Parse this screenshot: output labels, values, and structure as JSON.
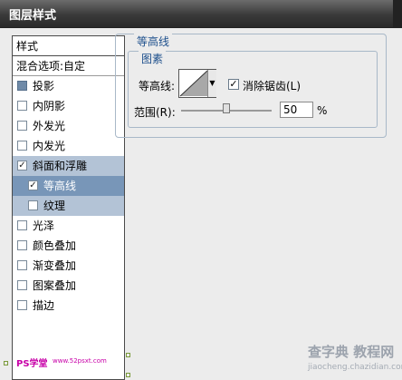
{
  "window": {
    "title": "图层样式"
  },
  "sidebar": {
    "header": "样式",
    "blend_options": "混合选项:自定",
    "items": [
      {
        "label": "投影",
        "checked": false
      },
      {
        "label": "内阴影",
        "checked": false
      },
      {
        "label": "外发光",
        "checked": false
      },
      {
        "label": "内发光",
        "checked": false
      },
      {
        "label": "斜面和浮雕",
        "checked": true
      },
      {
        "label": "等高线",
        "checked": true
      },
      {
        "label": "纹理",
        "checked": false
      },
      {
        "label": "光泽",
        "checked": false
      },
      {
        "label": "颜色叠加",
        "checked": false
      },
      {
        "label": "渐变叠加",
        "checked": false
      },
      {
        "label": "图案叠加",
        "checked": false
      },
      {
        "label": "描边",
        "checked": false
      }
    ]
  },
  "contour": {
    "group_title": "等高线",
    "subgroup_title": "图素",
    "contour_label": "等高线:",
    "antialias_label": "消除锯齿(L)",
    "antialias_checked": true,
    "range_label": "范围(R):",
    "range_value": "50",
    "range_unit": "%",
    "range_fraction": 0.5
  },
  "watermark": {
    "main": "查字典 教程网",
    "sub": "jiaocheng.chazidian.com",
    "ps_mark": "PS学堂",
    "ps_url": "www.52psxt.com"
  },
  "colors": {
    "accent": "#1d4f8c",
    "selected_bg": "#7896b8",
    "sub_bg": "#b3c3d6",
    "title_bar": "#3a3a3a"
  }
}
